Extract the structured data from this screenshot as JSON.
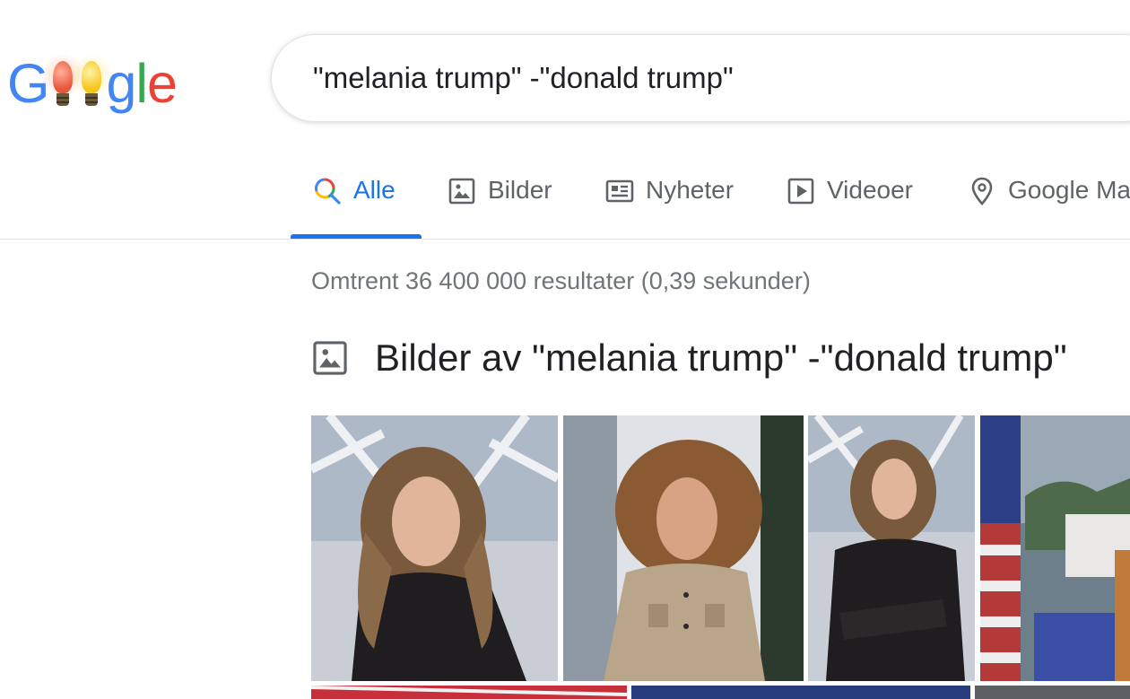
{
  "logo": {
    "text_g": "G",
    "text_gle": "gle"
  },
  "search": {
    "query": "\"melania trump\" -\"donald trump\""
  },
  "tabs": [
    {
      "label": "Alle",
      "icon": "search-icon",
      "active": true
    },
    {
      "label": "Bilder",
      "icon": "image-icon",
      "active": false
    },
    {
      "label": "Nyheter",
      "icon": "news-icon",
      "active": false
    },
    {
      "label": "Videoer",
      "icon": "play-icon",
      "active": false
    },
    {
      "label": "Google Maps",
      "icon": "location-pin-icon",
      "active": false
    }
  ],
  "results": {
    "stats": "Omtrent 36 400 000 resultater (0,39 sekunder)"
  },
  "images_section": {
    "title": "Bilder av \"melania trump\" -\"donald trump\"",
    "icon": "image-icon"
  },
  "colors": {
    "accent": "#1a73e8",
    "text_primary": "#202124",
    "text_secondary": "#5f6368",
    "stats": "#70757a",
    "google_blue": "#4285f4",
    "google_red": "#ea4335",
    "google_yellow": "#fbbc05",
    "google_green": "#34a853"
  }
}
